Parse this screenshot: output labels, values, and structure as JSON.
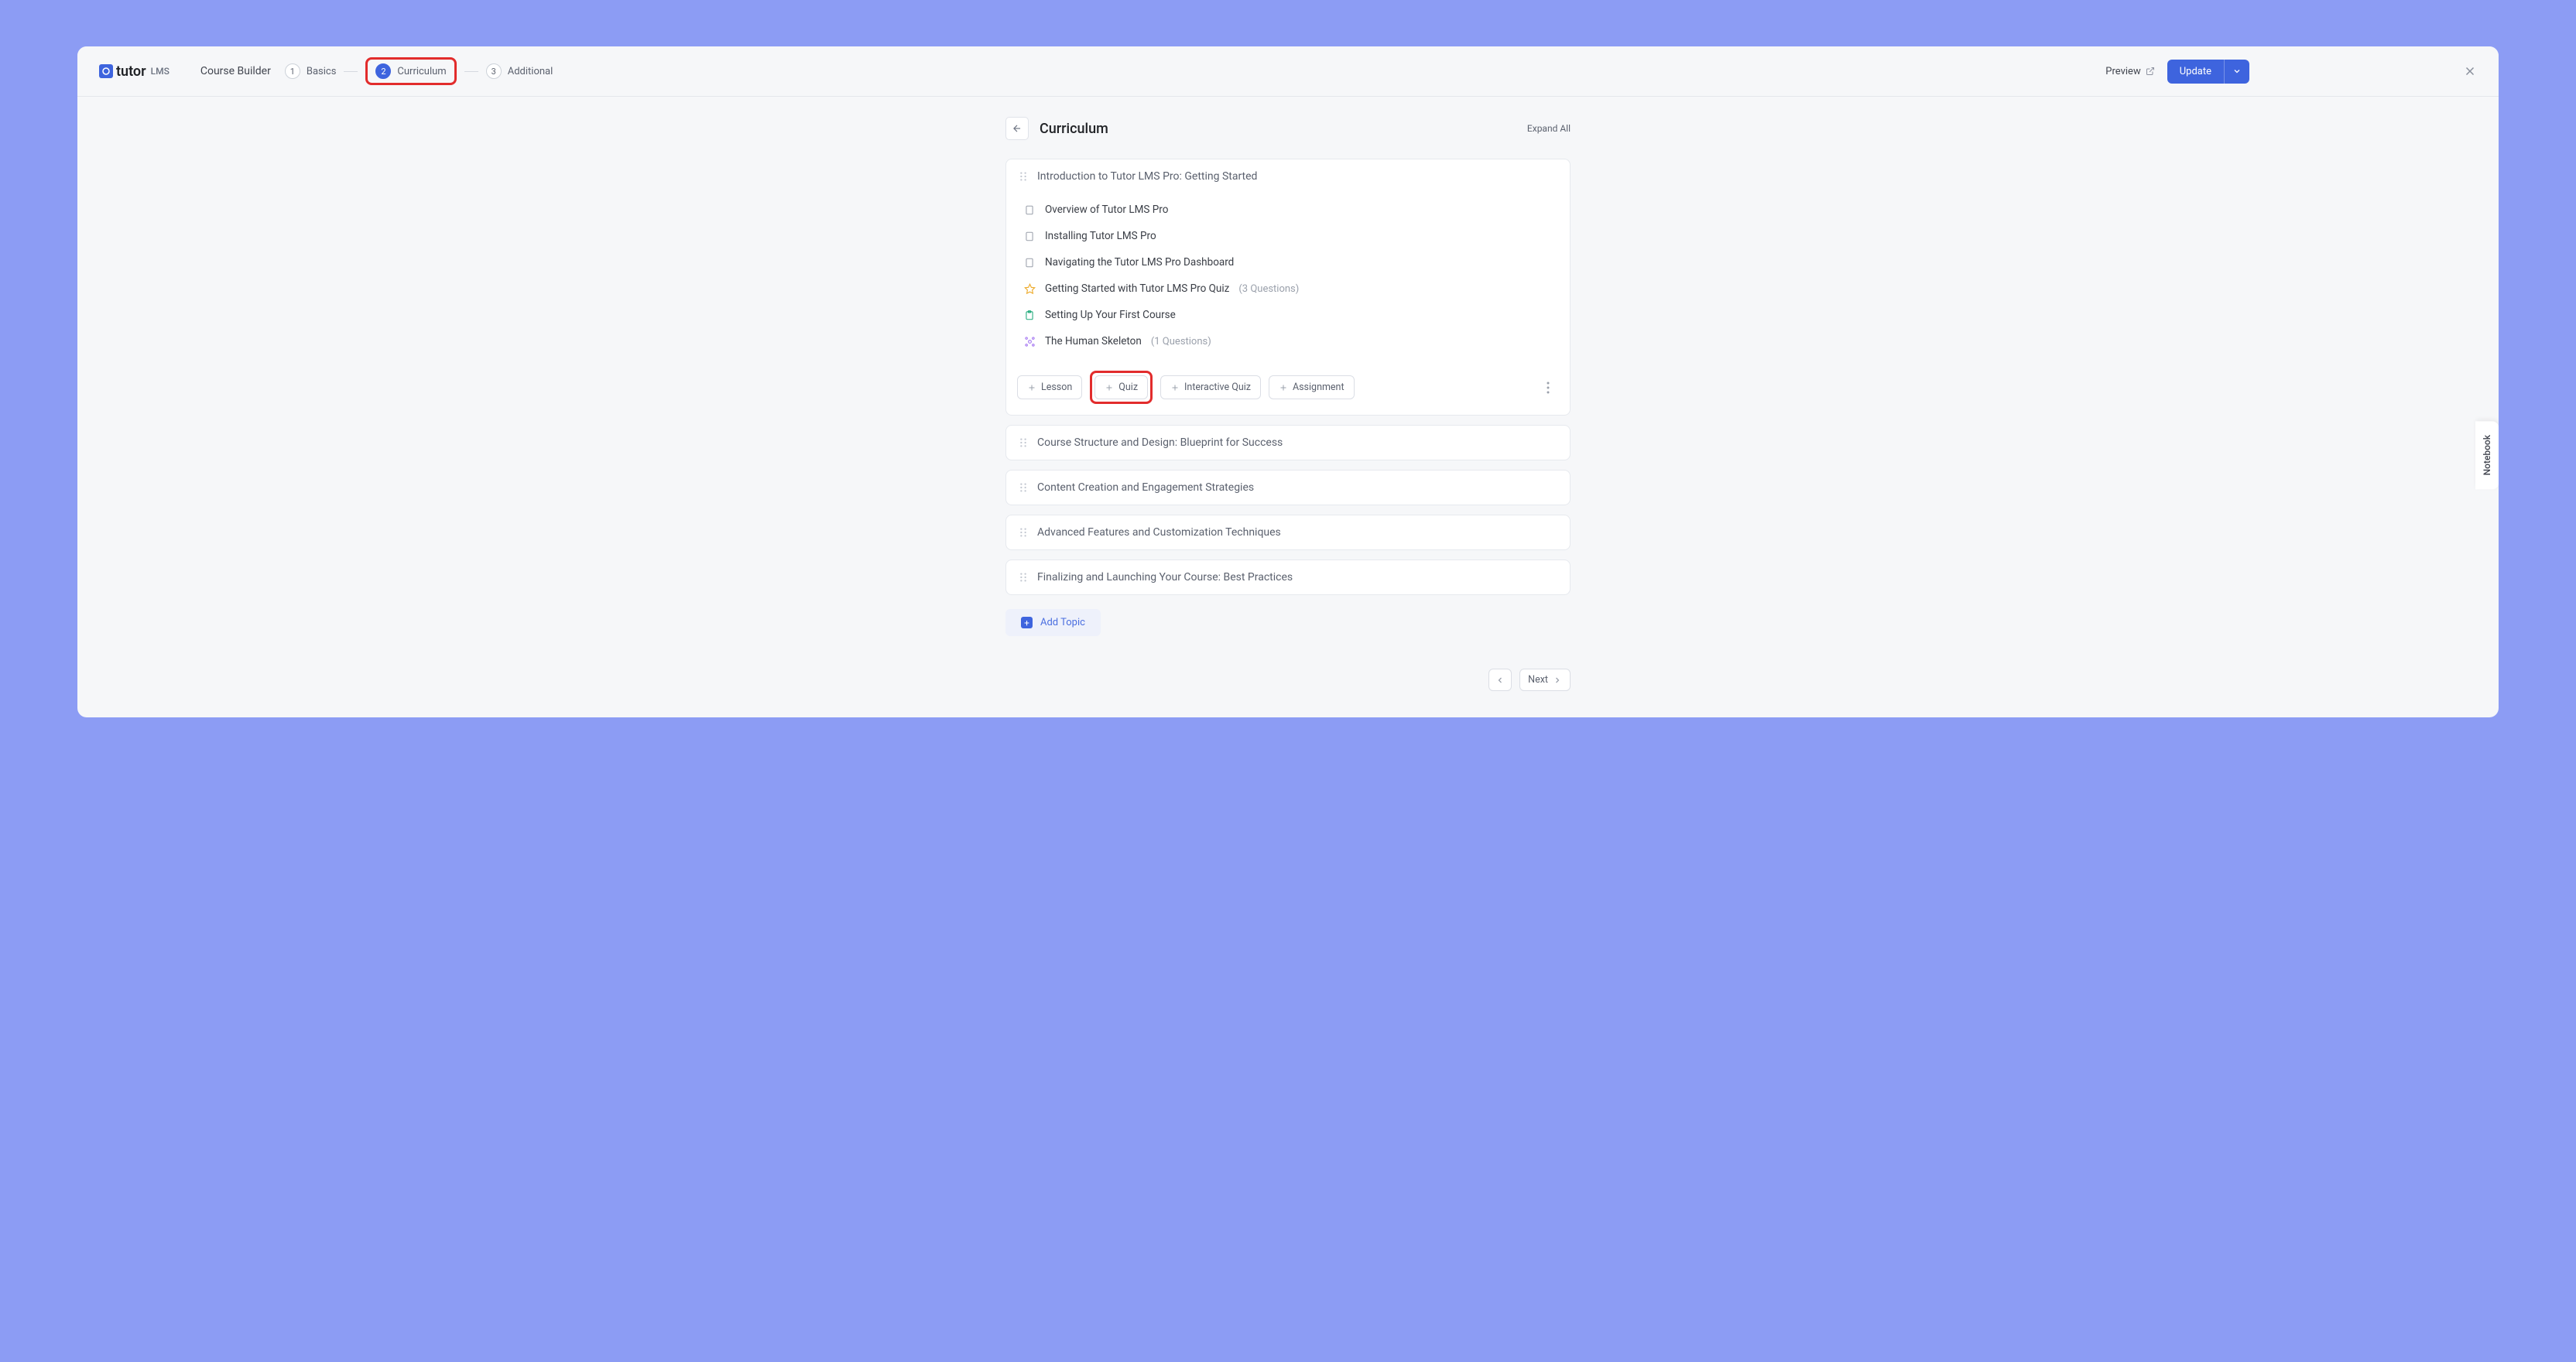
{
  "brand": {
    "name": "tutor",
    "suffix": "LMS"
  },
  "header": {
    "builder_title": "Course Builder",
    "steps": [
      {
        "num": "1",
        "label": "Basics",
        "active": false,
        "highlighted": false
      },
      {
        "num": "2",
        "label": "Curriculum",
        "active": true,
        "highlighted": true
      },
      {
        "num": "3",
        "label": "Additional",
        "active": false,
        "highlighted": false
      }
    ],
    "preview_label": "Preview",
    "update_label": "Update"
  },
  "page": {
    "title": "Curriculum",
    "expand_all": "Expand All"
  },
  "topics": [
    {
      "title": "Introduction to Tutor LMS Pro: Getting Started",
      "expanded": true,
      "items": [
        {
          "type": "lesson",
          "title": "Overview of Tutor LMS Pro",
          "meta": ""
        },
        {
          "type": "lesson",
          "title": "Installing Tutor LMS Pro",
          "meta": ""
        },
        {
          "type": "lesson",
          "title": "Navigating the Tutor LMS Pro Dashboard",
          "meta": ""
        },
        {
          "type": "quiz",
          "title": "Getting Started with Tutor LMS Pro Quiz",
          "meta": "(3 Questions)"
        },
        {
          "type": "assignment",
          "title": "Setting Up Your First Course",
          "meta": ""
        },
        {
          "type": "interactive-quiz",
          "title": "The Human Skeleton",
          "meta": "(1 Questions)"
        }
      ],
      "actions": [
        {
          "key": "lesson",
          "label": "Lesson",
          "highlighted": false
        },
        {
          "key": "quiz",
          "label": "Quiz",
          "highlighted": true
        },
        {
          "key": "interactive-quiz",
          "label": "Interactive Quiz",
          "highlighted": false
        },
        {
          "key": "assignment",
          "label": "Assignment",
          "highlighted": false
        }
      ]
    },
    {
      "title": "Course Structure and Design: Blueprint for Success",
      "expanded": false
    },
    {
      "title": "Content Creation and Engagement Strategies",
      "expanded": false
    },
    {
      "title": "Advanced Features and Customization Techniques",
      "expanded": false
    },
    {
      "title": "Finalizing and Launching Your Course: Best Practices",
      "expanded": false
    }
  ],
  "add_topic_label": "Add Topic",
  "footer": {
    "next": "Next"
  },
  "notebook_label": "Notebook"
}
